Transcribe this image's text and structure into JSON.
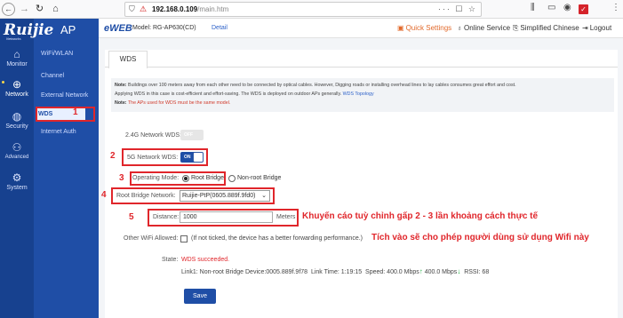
{
  "browser": {
    "back_icon": "arrow-left-icon",
    "url_host": "192.168.0.109",
    "url_path": "/main.htm",
    "url_actions": "··· ☐ ☆"
  },
  "sidebar": {
    "logo_text": "Ruijie",
    "logo_sub": "Networks",
    "logo_suffix": "AP",
    "rail": [
      {
        "label": "Monitor",
        "icon": "home-icon"
      },
      {
        "label": "Network",
        "icon": "globe-icon"
      },
      {
        "label": "Security",
        "icon": "shield-icon"
      },
      {
        "label": "Advanced",
        "icon": "users-icon"
      },
      {
        "label": "System",
        "icon": "gear-icon"
      }
    ],
    "menu": [
      {
        "label": "WiFi/WLAN"
      },
      {
        "label": "Channel"
      },
      {
        "label": "External Network"
      },
      {
        "label": "WDS"
      },
      {
        "label": "Internet Auth"
      }
    ],
    "wds_step": "1"
  },
  "header": {
    "brand": "eWEB",
    "model": "Model: RG-AP630(CD)",
    "detail": "Detail",
    "quick_settings": "Quick Settings",
    "online_service": "Online Service",
    "language": "Simplified Chinese",
    "logout": "Logout"
  },
  "tab": {
    "label": "WDS"
  },
  "note": {
    "line1_prefix": "Note:",
    "line1": "Buildings over 100 meters away from each other need to be connected by optical cables. However, Digging roads or installing overhead lines to lay cables consumes great effort and cost.",
    "line2": "Applying WDS in this case is cost-efficient and effort-saving. The WDS is deployed on outdoor APs generally.",
    "line2_link": "WDS Topology",
    "line3_prefix": "Note:",
    "line3": "The APs used for WDS must be the same model."
  },
  "form": {
    "wds24_label": "2.4G Network WDS:",
    "wds24_state": "OFF",
    "wds5_label": "5G Network WDS:",
    "wds5_state": "ON",
    "mode_label": "Operating Mode:",
    "mode_root": "Root Bridge",
    "mode_nonroot": "Non-root Bridge",
    "mode_selected": "Root Bridge",
    "root_net_label": "Root Bridge Network:",
    "root_net_value": "Ruijie-PtP(0605.889f.9fd0)",
    "distance_label": "Distance:",
    "distance_value": "1000",
    "distance_unit": "Meters",
    "other_wifi_label": "Other WiFi Allowed:",
    "other_wifi_hint": "(If not ticked, the device has a better forwarding performance.)",
    "other_wifi_checked": false,
    "state_label": "State:",
    "state_value": "WDS succeeded.",
    "link_prefix": "Link1:",
    "link_device": "Non-root Bridge Device:0005.889f.9f78",
    "link_time": "Link Time: 1:19:15",
    "link_speed_prefix": "Speed: 400.0 Mbps",
    "link_speed_down": "400.0 Mbps",
    "link_rssi": "RSSI: 68",
    "save_label": "Save"
  },
  "annotations": {
    "step2": "2",
    "step3": "3",
    "step4": "4",
    "step5": "5",
    "distance_tip": "Khuyến cáo tuỳ chỉnh gấp 2 - 3 lần khoảng cách thực tế",
    "wifi_tip": "Tích vào sẽ cho phép người dùng sử dụng Wifi này"
  },
  "colors": {
    "sidebar": "#1f4ea6",
    "accent": "#1f4ea6",
    "annotation_red": "#e0262b",
    "quick_settings": "#e26a2c"
  }
}
